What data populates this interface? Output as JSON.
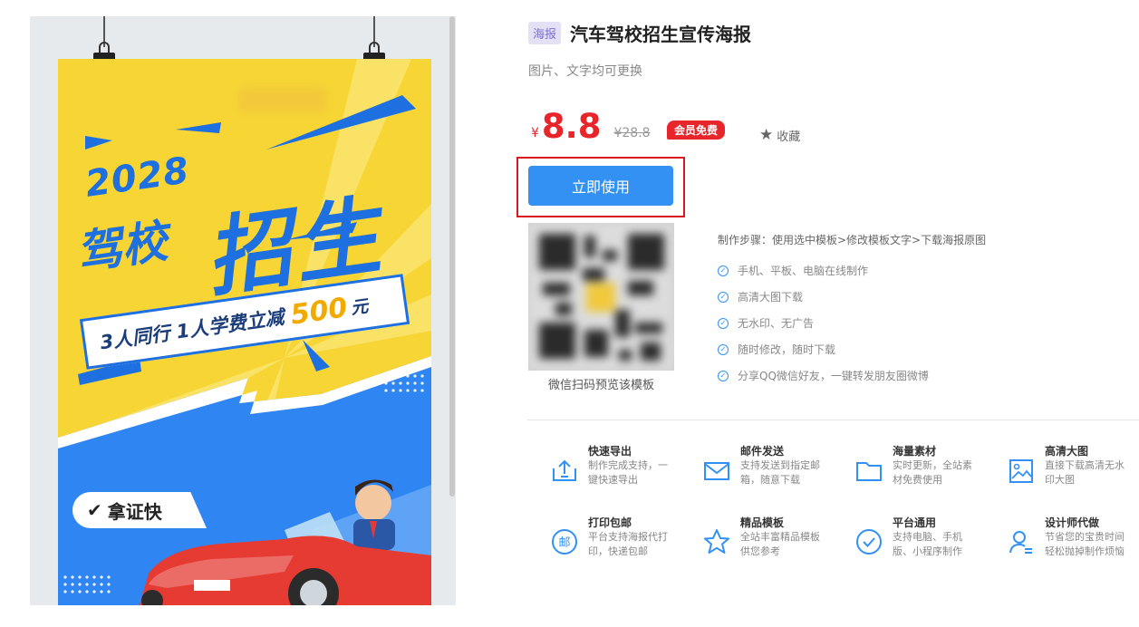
{
  "poster": {
    "year": "2028",
    "school": "驾校",
    "enroll": "招生",
    "offer": "3人同行  1人学费立减",
    "amount": "500",
    "unit": "元",
    "tag": "拿证快"
  },
  "product": {
    "type_badge": "海报",
    "title": "汽车驾校招生宣传海报",
    "subtitle": "图片、文字均可更换",
    "currency": "¥",
    "price": "8.8",
    "original_price": "¥28.8",
    "vip_badge": "会员免费",
    "favorite_label": "收藏",
    "use_button": "立即使用",
    "qr_caption": "微信扫码预览该模板"
  },
  "steps": {
    "title": "制作步骤：使用选中模板>修改模板文字>下载海报原图",
    "items": [
      "手机、平板、电脑在线制作",
      "高清大图下载",
      "无水印、无广告",
      "随时修改，随时下载",
      "分享QQ微信好友，一键转发朋友圈微博"
    ]
  },
  "features": [
    {
      "title": "快速导出",
      "desc": "制作完成支持，一键快速导出",
      "icon": "export-icon"
    },
    {
      "title": "邮件发送",
      "desc": "支持发送到指定邮箱，随意下载",
      "icon": "mail-icon"
    },
    {
      "title": "海量素材",
      "desc": "实时更新，全站素材免费使用",
      "icon": "folder-icon"
    },
    {
      "title": "高清大图",
      "desc": "直接下载高清无水印大图",
      "icon": "image-icon"
    },
    {
      "title": "打印包邮",
      "desc": "平台支持海报代打印，快递包邮",
      "icon": "post-icon",
      "glyph": "邮"
    },
    {
      "title": "精品模板",
      "desc": "全站丰富精品模板供您参考",
      "icon": "star-icon"
    },
    {
      "title": "平台通用",
      "desc": "支持电脑、手机版、小程序制作",
      "icon": "check-circle-icon"
    },
    {
      "title": "设计师代做",
      "desc": "节省您的宝贵时间轻松抛掉制作烦恼",
      "icon": "designer-icon"
    }
  ],
  "colors": {
    "accent_blue": "#3391f3",
    "price_red": "#e8252b",
    "poster_yellow": "#f6d535",
    "poster_blue": "#1e6fe0"
  }
}
